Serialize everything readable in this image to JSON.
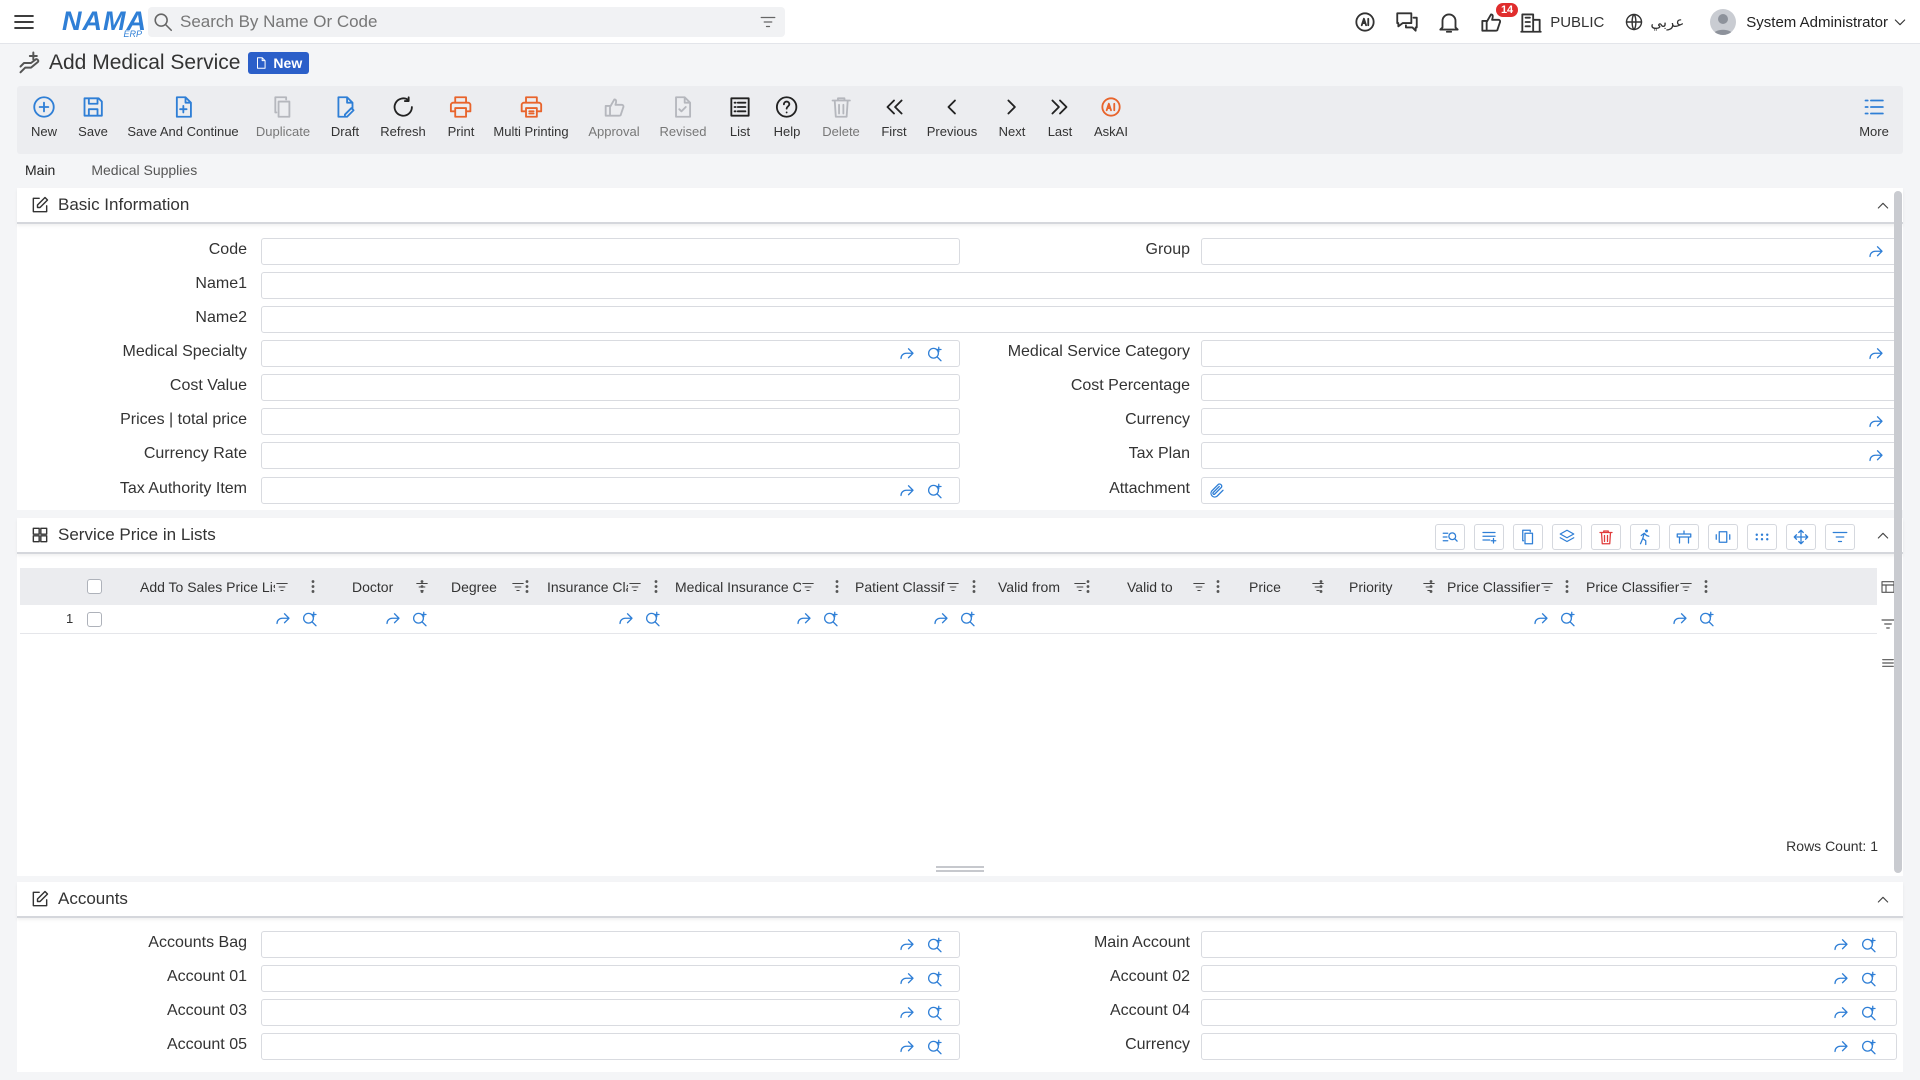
{
  "topbar": {
    "logo_main": "NAMA",
    "logo_sub": "ERP",
    "search_placeholder": "Search By Name Or Code",
    "notification_count": "14",
    "branch": "PUBLIC",
    "language": "عربي",
    "user": "System Administrator"
  },
  "page": {
    "title": "Add Medical Service",
    "status_badge": "New"
  },
  "toolbar": {
    "new": "New",
    "save": "Save",
    "save_continue": "Save And Continue",
    "duplicate": "Duplicate",
    "draft": "Draft",
    "refresh": "Refresh",
    "print": "Print",
    "multi_printing": "Multi Printing",
    "approval": "Approval",
    "revised": "Revised",
    "list": "List",
    "help": "Help",
    "delete": "Delete",
    "first": "First",
    "previous": "Previous",
    "next": "Next",
    "last": "Last",
    "askai": "AskAI",
    "more": "More"
  },
  "tabs": [
    "Main",
    "Medical Supplies"
  ],
  "basic_info": {
    "title": "Basic Information",
    "code": "Code",
    "group": "Group",
    "name1": "Name1",
    "name2": "Name2",
    "medical_specialty": "Medical Specialty",
    "medical_service_category": "Medical Service Category",
    "cost_value": "Cost Value",
    "cost_percentage": "Cost Percentage",
    "prices_total": "Prices | total price",
    "currency": "Currency",
    "currency_rate": "Currency Rate",
    "tax_plan": "Tax Plan",
    "tax_authority_item": "Tax Authority Item",
    "attachment": "Attachment"
  },
  "price_lists": {
    "title": "Service Price in Lists",
    "columns": [
      "Add To Sales Price List",
      "Doctor",
      "Degree",
      "Insurance Cla",
      "Medical Insurance Co",
      "Patient Classif",
      "Valid from",
      "Valid to",
      "Price",
      "Priority",
      "Price Classifier",
      "Price Classifier"
    ],
    "row_number": "1",
    "rows_count": "Rows Count: 1"
  },
  "accounts": {
    "title": "Accounts",
    "accounts_bag": "Accounts Bag",
    "main_account": "Main Account",
    "account_01": "Account 01",
    "account_02": "Account 02",
    "account_03": "Account 03",
    "account_04": "Account 04",
    "account_05": "Account 05",
    "currency": "Currency"
  },
  "colors": {
    "accent": "#2f7fd6",
    "badge": "#2b5fc9",
    "print": "#e8642c",
    "notify": "#e02d2d"
  }
}
